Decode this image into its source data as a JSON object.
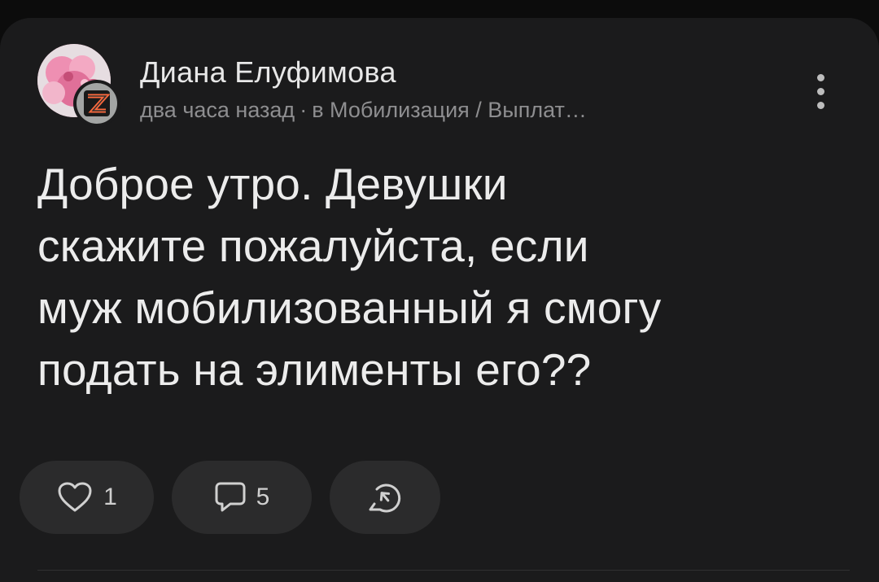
{
  "post": {
    "author": "Диана Елуфимова",
    "time": "два часа назад",
    "separator": "·",
    "community": "в Мобилизация / Выплат…",
    "text": "Доброе утро. Девушки\nскажите пожалуйста, если\nмуж мобилизованный я смогу\nподать на элименты его??"
  },
  "actions": {
    "like_count": "1",
    "comment_count": "5"
  },
  "icons": {
    "like": "heart-outline-icon",
    "comment": "speech-bubble-icon",
    "share": "share-arrow-icon",
    "more": "vertical-dots-icon",
    "badge": "z-emblem-icon"
  },
  "colors": {
    "background": "#0c0c0c",
    "card": "#1b1b1c",
    "pill": "#2b2b2c",
    "text_primary": "#ececec",
    "text_secondary": "#8e8e90"
  }
}
